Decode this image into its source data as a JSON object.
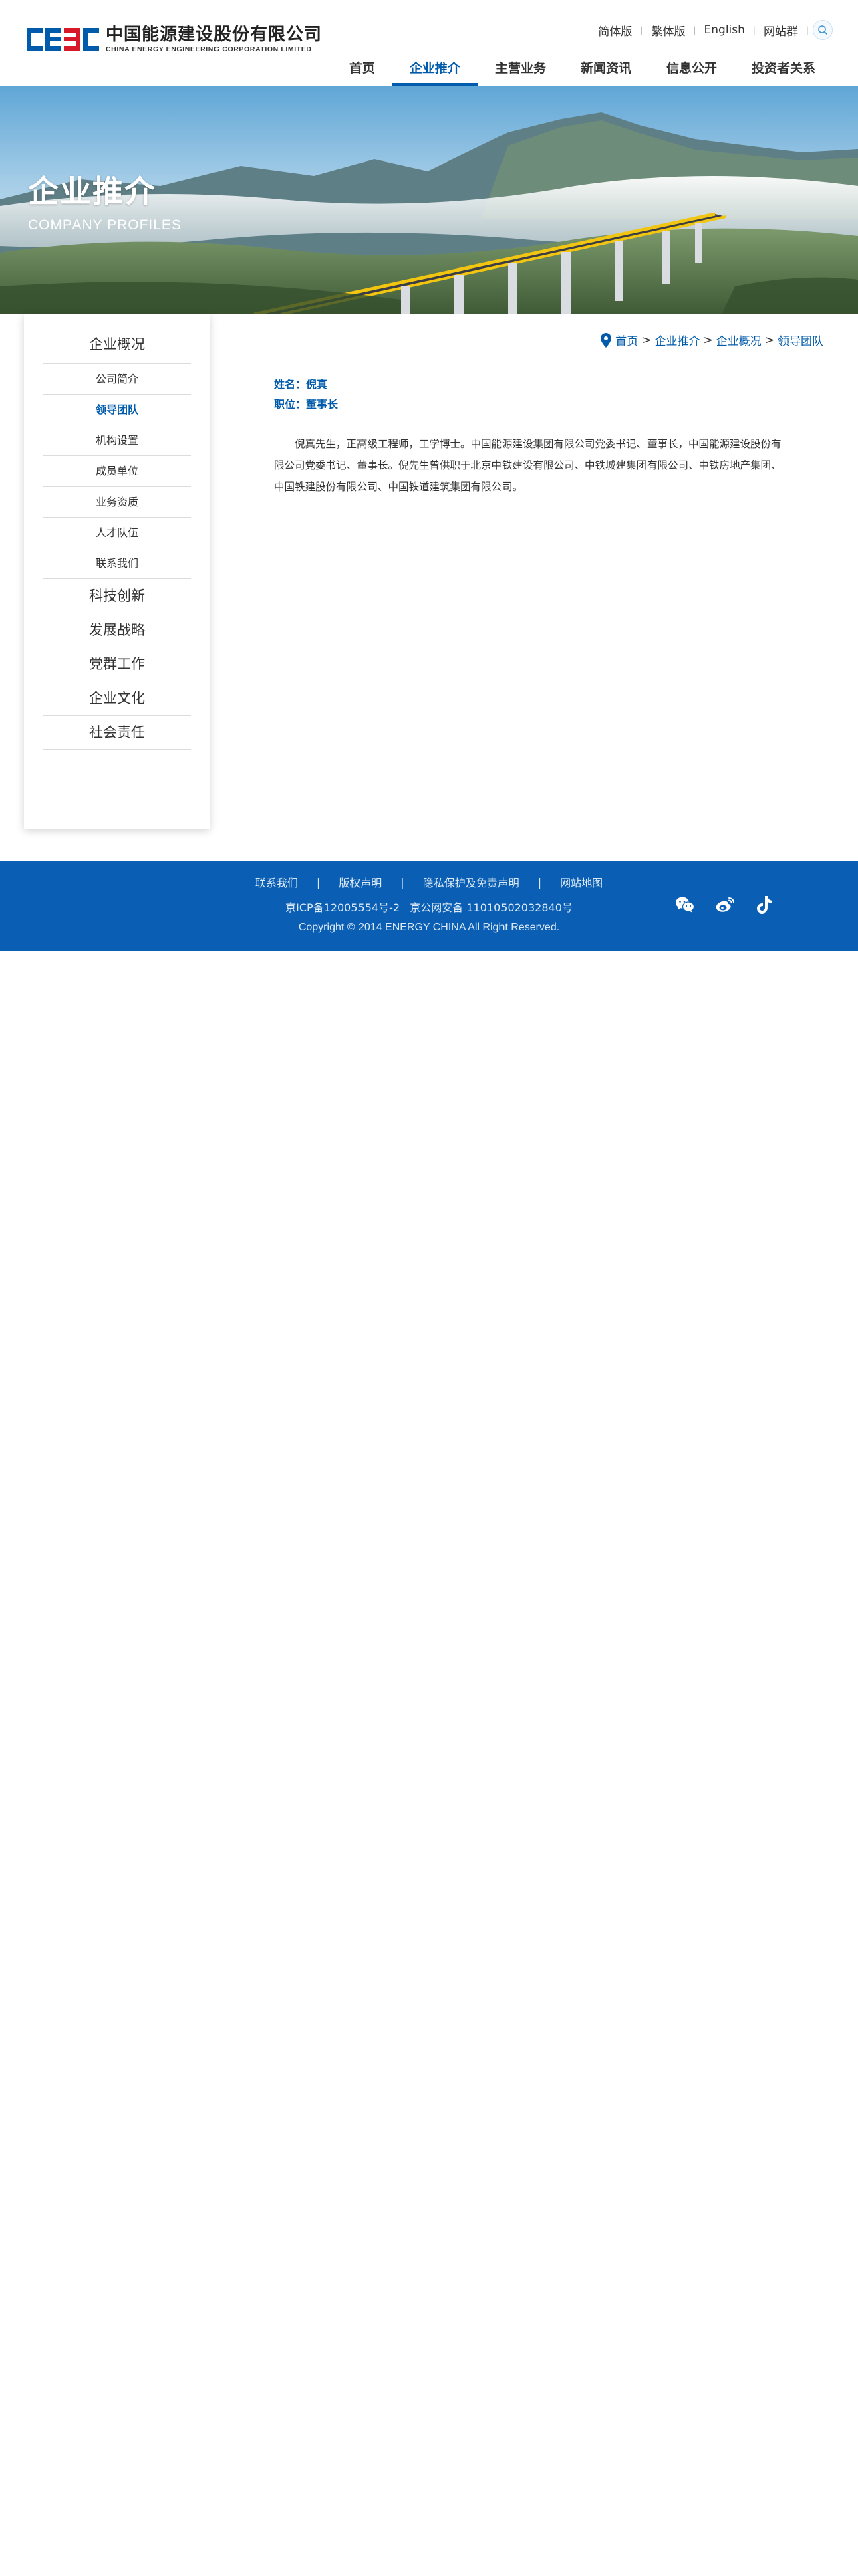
{
  "header": {
    "logo_cn": "中国能源建设股份有限公司",
    "logo_en": "CHINA ENERGY ENGINEERING CORPORATION LIMITED",
    "top_links": [
      "简体版",
      "繁体版",
      "English",
      "网站群"
    ],
    "nav": [
      "首页",
      "企业推介",
      "主营业务",
      "新闻资讯",
      "信息公开",
      "投资者关系"
    ],
    "active_nav": "企业推介"
  },
  "banner": {
    "title": "企业推介",
    "subtitle": "COMPANY PROFILES"
  },
  "sidebar": {
    "section_title": "企业概况",
    "sub_items": [
      "公司简介",
      "领导团队",
      "机构设置",
      "成员单位",
      "业务资质",
      "人才队伍",
      "联系我们"
    ],
    "active_sub": "领导团队",
    "main_items": [
      "科技创新",
      "发展战略",
      "党群工作",
      "企业文化",
      "社会责任"
    ]
  },
  "breadcrumb": [
    "首页",
    "企业推介",
    "企业概况",
    "领导团队"
  ],
  "profile": {
    "name_line": "姓名：倪真",
    "position_line": "职位：董事长",
    "bio": "倪真先生，正高级工程师，工学博士。中国能源建设集团有限公司党委书记、董事长，中国能源建设股份有限公司党委书记、董事长。倪先生曾供职于北京中铁建设有限公司、中铁城建集团有限公司、中铁房地产集团、中国铁建股份有限公司、中国铁道建筑集团有限公司。"
  },
  "footer": {
    "links": [
      "联系我们",
      "版权声明",
      "隐私保护及免责声明",
      "网站地图"
    ],
    "icp": "京ICP备12005554号-2   京公网安备 11010502032840号",
    "copyright": "Copyright © 2014 ENERGY CHINA All Right Reserved."
  },
  "colors": {
    "brand_blue": "#005bac",
    "footer_blue": "#0a5fb4",
    "logo_red": "#d7192a"
  },
  "icons": [
    "search-icon",
    "location-pin-icon",
    "wechat-icon",
    "weibo-icon",
    "douyin-icon"
  ]
}
